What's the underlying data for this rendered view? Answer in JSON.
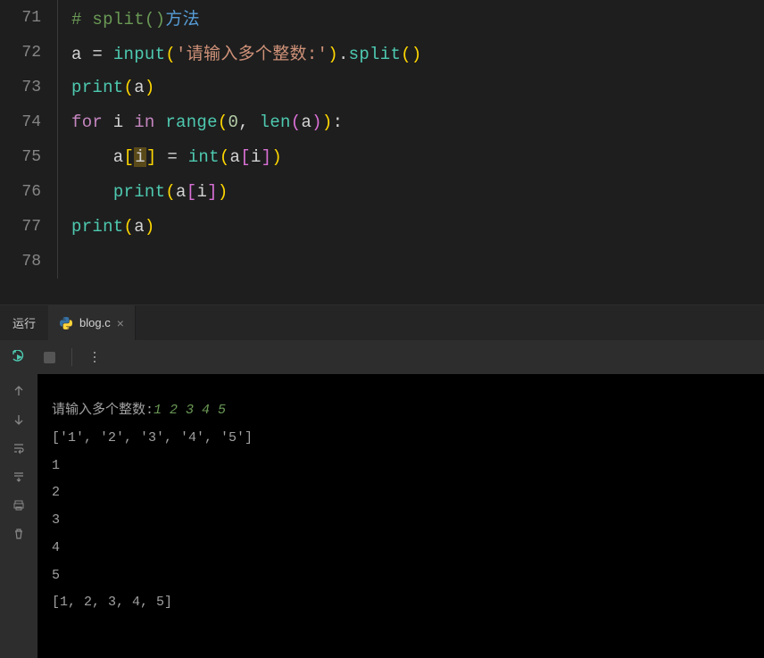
{
  "editor": {
    "lines": [
      {
        "num": "71"
      },
      {
        "num": "72"
      },
      {
        "num": "73"
      },
      {
        "num": "74"
      },
      {
        "num": "75"
      },
      {
        "num": "76"
      },
      {
        "num": "77"
      },
      {
        "num": "78"
      }
    ],
    "code": {
      "l71_hash": "# ",
      "l71_split": "split()",
      "l71_cn": "方法",
      "l72_a": "a ",
      "l72_eq": "= ",
      "l72_input": "input",
      "l72_lp": "(",
      "l72_str": "'请输入多个整数:'",
      "l72_rp": ")",
      "l72_dot": ".",
      "l72_split": "split",
      "l72_lp2": "(",
      "l72_rp2": ")",
      "l73_print": "print",
      "l73_lp": "(",
      "l73_a": "a",
      "l73_rp": ")",
      "l74_for": "for",
      "l74_i": " i ",
      "l74_in": "in",
      "l74_sp": " ",
      "l74_range": "range",
      "l74_lp": "(",
      "l74_0": "0",
      "l74_comma": ", ",
      "l74_len": "len",
      "l74_lp2": "(",
      "l74_a": "a",
      "l74_rp2": ")",
      "l74_rp": ")",
      "l74_colon": ":",
      "l75_indent": "    a",
      "l75_lb": "[",
      "l75_i": "i",
      "l75_rb": "]",
      "l75_eq": " = ",
      "l75_int": "int",
      "l75_lp": "(",
      "l75_a": "a",
      "l75_lb2": "[",
      "l75_i2": "i",
      "l75_rb2": "]",
      "l75_rp": ")",
      "l76_indent": "    ",
      "l76_print": "print",
      "l76_lp": "(",
      "l76_a": "a",
      "l76_lb": "[",
      "l76_i": "i",
      "l76_rb": "]",
      "l76_rp": ")",
      "l77_print": "print",
      "l77_lp": "(",
      "l77_a": "a",
      "l77_rp": ")"
    }
  },
  "tabbar": {
    "run_label": "运行",
    "tab_name": "blog.c",
    "tab_close": "×"
  },
  "terminal": {
    "prompt_label": "请输入多个整数:",
    "user_input": "1 2 3 4 5",
    "out1": "['1', '2', '3', '4', '5']",
    "out2": "1",
    "out3": "2",
    "out4": "3",
    "out5": "4",
    "out6": "5",
    "out7": "[1, 2, 3, 4, 5]"
  }
}
